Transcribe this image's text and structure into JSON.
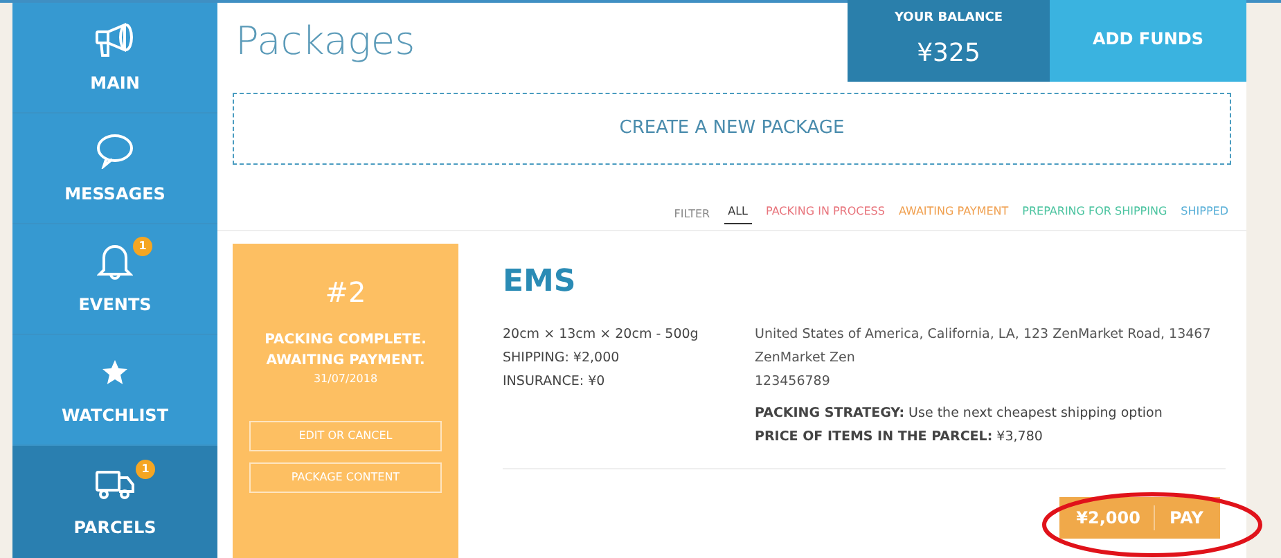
{
  "sidebar": {
    "items": [
      {
        "label": "MAIN",
        "selected": false
      },
      {
        "label": "MESSAGES",
        "selected": false
      },
      {
        "label": "EVENTS",
        "selected": false,
        "badge": "1"
      },
      {
        "label": "WATCHLIST",
        "selected": false
      },
      {
        "label": "PARCELS",
        "selected": true,
        "badge": "1"
      }
    ]
  },
  "header": {
    "title": "Packages",
    "balance_label": "YOUR BALANCE",
    "balance": "¥325",
    "add_funds": "ADD FUNDS"
  },
  "create_button": "CREATE A NEW PACKAGE",
  "filter": {
    "label": "FILTER",
    "options": [
      {
        "label": "ALL",
        "selected": true,
        "color": "#333333"
      },
      {
        "label": "PACKING IN PROCESS",
        "selected": false,
        "color": "#e8747c"
      },
      {
        "label": "AWAITING PAYMENT",
        "selected": false,
        "color": "#f0a050"
      },
      {
        "label": "PREPARING FOR SHIPPING",
        "selected": false,
        "color": "#4cc4a0"
      },
      {
        "label": "SHIPPED",
        "selected": false,
        "color": "#5ab0d8"
      }
    ]
  },
  "package": {
    "number": "#2",
    "status": "PACKING COMPLETE. AWAITING PAYMENT.",
    "date": "31/07/2018",
    "buttons": [
      "EDIT OR CANCEL",
      "PACKAGE CONTENT"
    ],
    "method": "EMS",
    "dimensions": "20cm × 13cm × 20cm - 500g",
    "shipping": "SHIPPING: ¥2,000",
    "insurance": "INSURANCE: ¥0",
    "address": [
      "United States of America, California, LA, 123 ZenMarket Road, 13467",
      "ZenMarket Zen",
      "123456789"
    ],
    "strategy": "**PACKING STRATEGY:** Use the next cheapest shipping option",
    "price": "**PRICE OF ITEMS IN THE PARCEL:** ¥3,780",
    "pay_amount": "¥2,000",
    "pay_label": "PAY"
  }
}
